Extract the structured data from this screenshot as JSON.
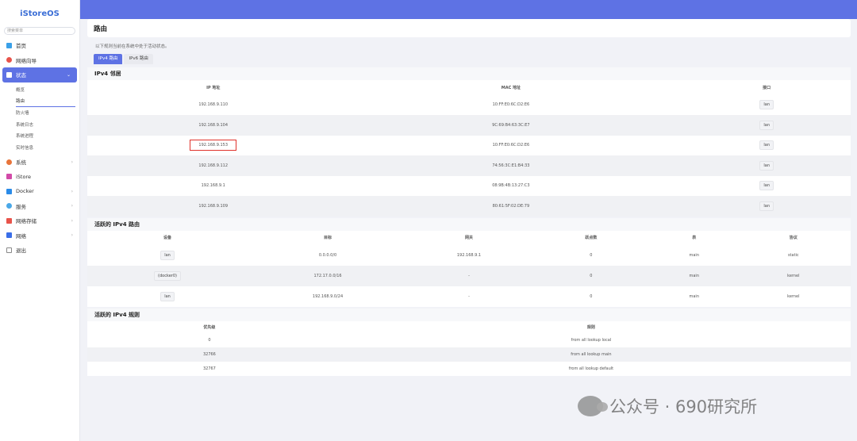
{
  "sidebar": {
    "brand": "iStoreOS",
    "search_placeholder": "搜索菜单",
    "items": [
      {
        "label": "首页",
        "icon": "home-icon",
        "color": "#3aa0e8"
      },
      {
        "label": "网络向导",
        "icon": "wizard-icon",
        "color": "#e8534a"
      },
      {
        "label": "状态",
        "icon": "status-icon",
        "color": "#ffffff",
        "active": true
      },
      {
        "label": "系统",
        "icon": "system-icon",
        "color": "#e8743a"
      },
      {
        "label": "iStore",
        "icon": "store-icon",
        "color": "#d24aa8"
      },
      {
        "label": "Docker",
        "icon": "docker-icon",
        "color": "#2a8be8"
      },
      {
        "label": "服务",
        "icon": "service-icon",
        "color": "#4aa8e8"
      },
      {
        "label": "网络存储",
        "icon": "storage-icon",
        "color": "#e8534a"
      },
      {
        "label": "网络",
        "icon": "network-icon",
        "color": "#3a6ee8"
      },
      {
        "label": "退出",
        "icon": "logout-icon",
        "color": "#888888"
      }
    ],
    "status_sub": [
      "概览",
      "路由",
      "防火墙",
      "系统日志",
      "系统进程",
      "实时信息"
    ]
  },
  "page": {
    "title": "路由",
    "description": "以下规则当前在系统中处于活动状态。",
    "tabs": [
      "IPv4 路由",
      "IPv6 路由"
    ]
  },
  "neighbors": {
    "title": "IPv4 邻居",
    "headers": [
      "IP 地址",
      "MAC 地址",
      "接口"
    ],
    "rows": [
      [
        "192.168.9.110",
        "10:FF:E0:6C:D2:E6",
        "lan"
      ],
      [
        "192.168.9.104",
        "9C:69:B4:63:3C:E7",
        "lan"
      ],
      [
        "192.168.9.153",
        "10:FF:E0:6C:D2:E6",
        "lan"
      ],
      [
        "192.168.9.112",
        "74:56:3C:E1:B4:33",
        "lan"
      ],
      [
        "192.168.9.1",
        "08:9B:4B:13:27:C3",
        "lan"
      ],
      [
        "192.168.9.109",
        "80:61:5F:02:DE:79",
        "lan"
      ]
    ]
  },
  "routes": {
    "title": "活跃的 IPv4 路由",
    "headers": [
      "设备",
      "目标",
      "网关",
      "跃点数",
      "表",
      "协议"
    ],
    "rows": [
      [
        "lan",
        "0.0.0.0/0",
        "192.168.9.1",
        "0",
        "main",
        "static"
      ],
      [
        "(docker0)",
        "172.17.0.0/16",
        "-",
        "0",
        "main",
        "kernel"
      ],
      [
        "lan",
        "192.168.9.0/24",
        "-",
        "0",
        "main",
        "kernel"
      ]
    ]
  },
  "rules": {
    "title": "活跃的 IPv4 规则",
    "headers": [
      "优先级",
      "规则"
    ],
    "rows": [
      [
        "0",
        "from all lookup local"
      ],
      [
        "32766",
        "from all lookup main"
      ],
      [
        "32767",
        "from all lookup default"
      ]
    ]
  },
  "watermark": "公众号 · 690研究所",
  "colors": {
    "accent": "#5e72e4",
    "highlight_box": "#e0332c"
  }
}
